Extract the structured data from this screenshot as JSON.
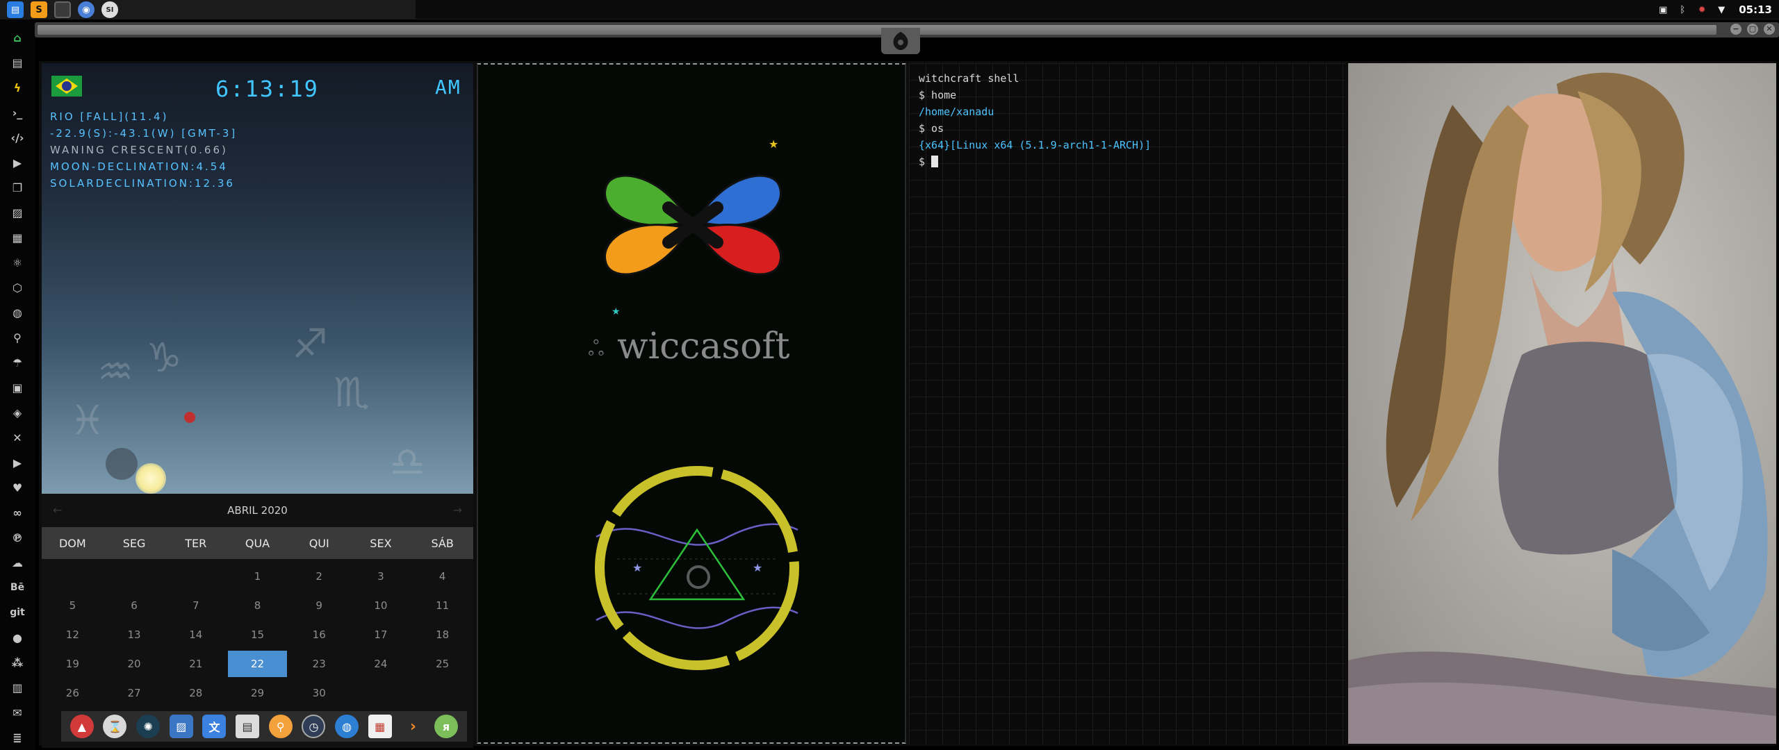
{
  "topbar": {
    "launchers": [
      "files-icon",
      "sublime-icon",
      "app-icon",
      "chromium-icon",
      "scientific-icon"
    ],
    "tray": [
      "image-viewer-icon",
      "bluetooth-icon",
      "bug-icon",
      "wifi-icon"
    ],
    "clock": "05:13"
  },
  "clock_widget": {
    "time": "6:13:19",
    "ampm": "AM",
    "lines": [
      "RIO [FALL](11.4)",
      "-22.9(S):-43.1(W) [GMT-3]",
      "WANING CRESCENT(0.66)",
      "MOON-DECLINATION:4.54",
      "SOLARDECLINATION:12.36"
    ]
  },
  "calendar": {
    "month": "ABRIL 2020",
    "prev": "←",
    "next": "→",
    "weekdays": [
      "DOM",
      "SEG",
      "TER",
      "QUA",
      "QUI",
      "SEX",
      "SÁB"
    ],
    "days": [
      [
        "",
        "",
        "",
        "1",
        "2",
        "3",
        "4"
      ],
      [
        "5",
        "6",
        "7",
        "8",
        "9",
        "10",
        "11"
      ],
      [
        "12",
        "13",
        "14",
        "15",
        "16",
        "17",
        "18"
      ],
      [
        "19",
        "20",
        "21",
        "22",
        "23",
        "24",
        "25"
      ],
      [
        "26",
        "27",
        "28",
        "29",
        "30",
        "",
        ""
      ]
    ],
    "today": "22"
  },
  "wiccasoft": {
    "name": "wiccasoft"
  },
  "terminal": {
    "lines": [
      {
        "text": "witchcraft shell",
        "color": "#d8d8d8"
      },
      {
        "text": "$ home",
        "color": "#d8d8d8"
      },
      {
        "text": "/home/xanadu",
        "color": "#4cc3ff"
      },
      {
        "text": "$ os",
        "color": "#d8d8d8"
      },
      {
        "text": "{x64}[Linux x64 (5.1.9-arch1-1-ARCH)]",
        "color": "#4cc3ff"
      }
    ],
    "prompt": "$"
  },
  "colors": {
    "accent": "#4b8fd3",
    "lcd": "#41c6ff",
    "terminal_blue": "#4cc3ff"
  }
}
